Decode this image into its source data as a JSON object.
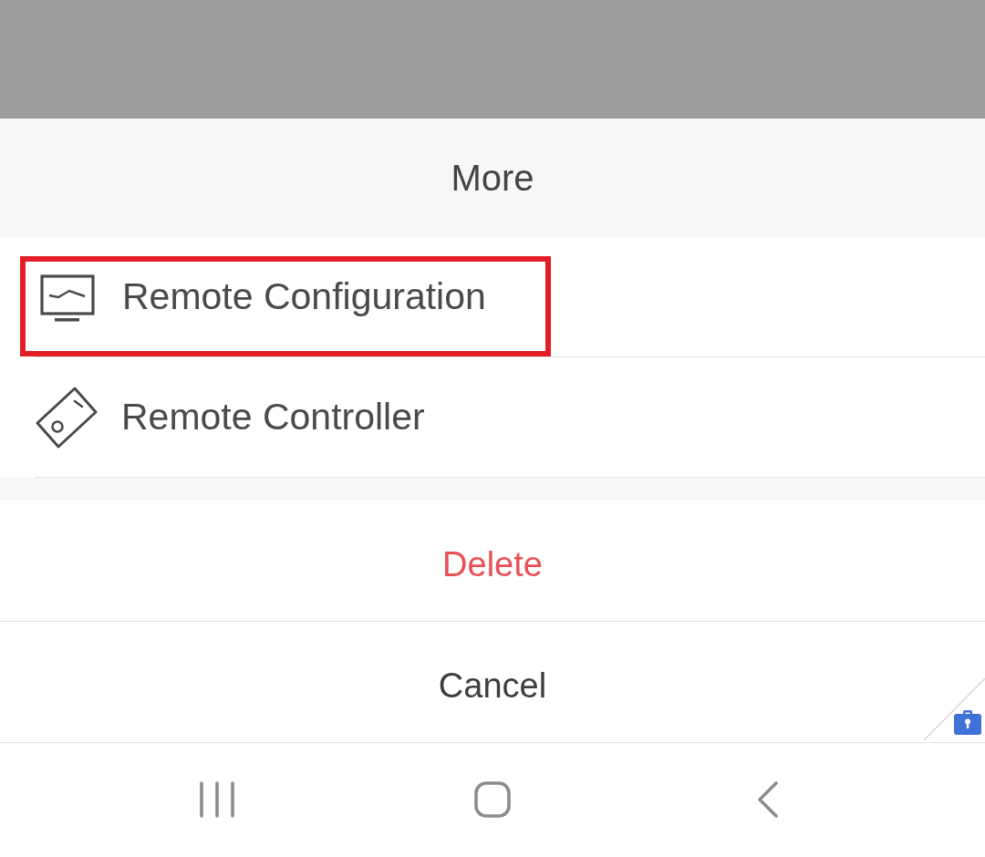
{
  "sheet": {
    "title": "More",
    "items": [
      {
        "label": "Remote Configuration",
        "highlighted": true
      },
      {
        "label": "Remote Controller",
        "highlighted": false
      }
    ],
    "actions": [
      {
        "label": "Delete",
        "kind": "destructive"
      },
      {
        "label": "Cancel",
        "kind": "normal"
      }
    ]
  }
}
